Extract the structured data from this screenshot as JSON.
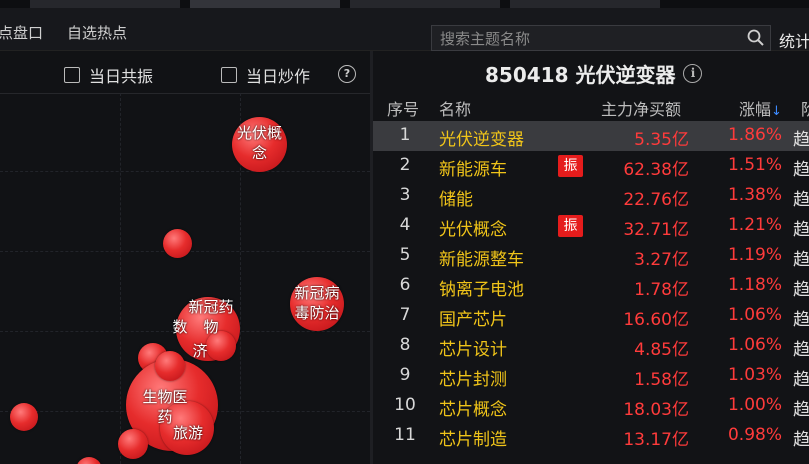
{
  "nav": {
    "subtabs": [
      "点盘口",
      "自选热点"
    ],
    "search_placeholder": "搜索主题名称",
    "stats_label": "统计"
  },
  "left": {
    "checkbox_resonance": "当日共振",
    "checkbox_speculation": "当日炒作",
    "help_glyph": "?",
    "bubbles": [
      {
        "label": "光伏概\n念"
      },
      {
        "label": "新冠病\n毒防治"
      },
      {
        "label": "新冠药\n物"
      },
      {
        "label": "生物医\n药"
      },
      {
        "label": "济"
      },
      {
        "label": "旅游"
      },
      {
        "label": "数"
      }
    ]
  },
  "right": {
    "title": "850418 光伏逆变器",
    "info_glyph": "i",
    "columns": {
      "idx": "序号",
      "name": "名称",
      "flow": "主力净买额",
      "pct": "涨幅",
      "trend": "阶"
    },
    "rows": [
      {
        "idx": "1",
        "name": "光伏逆变器",
        "badge": "",
        "flow": "5.35亿",
        "pct": "1.86%",
        "trend": "趋"
      },
      {
        "idx": "2",
        "name": "新能源车",
        "badge": "振",
        "flow": "62.38亿",
        "pct": "1.51%",
        "trend": "趋"
      },
      {
        "idx": "3",
        "name": "储能",
        "badge": "",
        "flow": "22.76亿",
        "pct": "1.38%",
        "trend": "趋"
      },
      {
        "idx": "4",
        "name": "光伏概念",
        "badge": "振",
        "flow": "32.71亿",
        "pct": "1.21%",
        "trend": "趋"
      },
      {
        "idx": "5",
        "name": "新能源整车",
        "badge": "",
        "flow": "3.27亿",
        "pct": "1.19%",
        "trend": "趋"
      },
      {
        "idx": "6",
        "name": "钠离子电池",
        "badge": "",
        "flow": "1.78亿",
        "pct": "1.18%",
        "trend": "趋"
      },
      {
        "idx": "7",
        "name": "国产芯片",
        "badge": "",
        "flow": "16.60亿",
        "pct": "1.06%",
        "trend": "趋"
      },
      {
        "idx": "8",
        "name": "芯片设计",
        "badge": "",
        "flow": "4.85亿",
        "pct": "1.06%",
        "trend": "趋"
      },
      {
        "idx": "9",
        "name": "芯片封测",
        "badge": "",
        "flow": "1.58亿",
        "pct": "1.03%",
        "trend": "趋"
      },
      {
        "idx": "10",
        "name": "芯片概念",
        "badge": "",
        "flow": "18.03亿",
        "pct": "1.00%",
        "trend": "趋"
      },
      {
        "idx": "11",
        "name": "芯片制造",
        "badge": "",
        "flow": "13.17亿",
        "pct": "0.98%",
        "trend": "趋"
      }
    ]
  }
}
